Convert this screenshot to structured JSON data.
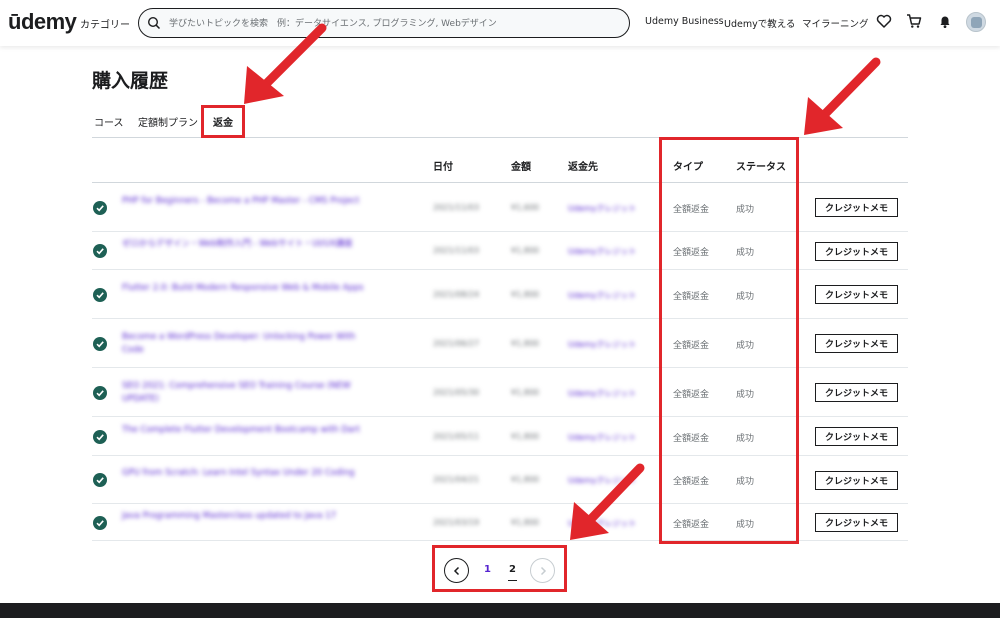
{
  "header": {
    "logo": "ūdemy",
    "categories": "カテゴリー",
    "search_placeholder": "学びたいトピックを検索　例：データサイエンス, プログラミング, Webデザイン",
    "links": [
      "Udemy Business",
      "Udemyで教える",
      "マイラーニング"
    ],
    "icons": [
      "heart-icon",
      "cart-icon",
      "bell-icon",
      "avatar"
    ]
  },
  "page": {
    "title": "購入履歴",
    "tabs": [
      {
        "label": "コース",
        "active": false
      },
      {
        "label": "定額制プラン",
        "active": false
      },
      {
        "label": "返金",
        "active": true
      }
    ]
  },
  "table": {
    "columns": {
      "date": "日付",
      "amount": "金額",
      "refund_to": "返金先",
      "type": "タイプ",
      "status": "ステータス"
    },
    "rows": [
      {
        "course": "PHP for Beginners - Become a PHP Master - CMS Project",
        "date": "2021/11/03",
        "amount": "¥1,600",
        "refund_to": "Udemyクレジット",
        "type": "全額返金",
        "status": "成功",
        "button": "クレジットメモ"
      },
      {
        "course": "ゼロからデザイン・Web制作入門 - Webサイト・UI/UX講座",
        "date": "2021/11/03",
        "amount": "¥1,800",
        "refund_to": "Udemyクレジット",
        "type": "全額返金",
        "status": "成功",
        "button": "クレジットメモ"
      },
      {
        "course": "Flutter 2.0: Build Modern Responsive Web & Mobile Apps",
        "date": "2021/08/24",
        "amount": "¥1,800",
        "refund_to": "Udemyクレジット",
        "type": "全額返金",
        "status": "成功",
        "button": "クレジットメモ"
      },
      {
        "course": "Become a WordPress Developer: Unlocking Power With Code",
        "date": "2021/06/27",
        "amount": "¥1,800",
        "refund_to": "Udemyクレジット",
        "type": "全額返金",
        "status": "成功",
        "button": "クレジットメモ"
      },
      {
        "course": "SEO 2021: Comprehensive SEO Training Course (NEW UPDATE)",
        "date": "2021/05/30",
        "amount": "¥1,800",
        "refund_to": "Udemyクレジット",
        "type": "全額返金",
        "status": "成功",
        "button": "クレジットメモ"
      },
      {
        "course": "The Complete Flutter Development Bootcamp with Dart",
        "date": "2021/05/11",
        "amount": "¥1,800",
        "refund_to": "Udemyクレジット",
        "type": "全額返金",
        "status": "成功",
        "button": "クレジットメモ"
      },
      {
        "course": "GPU from Scratch: Learn Intel Syntax Under 20 Coding",
        "date": "2021/04/21",
        "amount": "¥1,800",
        "refund_to": "Udemyクレジット",
        "type": "全額返金",
        "status": "成功",
        "button": "クレジットメモ"
      },
      {
        "course": "Java Programming Masterclass updated to Java 17",
        "date": "2021/03/19",
        "amount": "¥1,800",
        "refund_to": "Udemyクレジット",
        "type": "全額返金",
        "status": "成功",
        "button": "クレジットメモ"
      }
    ]
  },
  "pagination": {
    "pages": [
      "1",
      "2"
    ],
    "current": "2"
  },
  "colors": {
    "accent_purple": "#5624d0",
    "success_green": "#1e6055",
    "annotation_red": "#e1262b",
    "footer_dark": "#1c1d1f"
  }
}
